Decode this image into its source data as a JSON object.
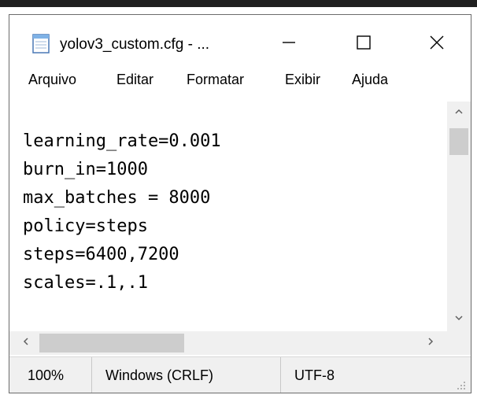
{
  "window": {
    "title": "yolov3_custom.cfg - ...",
    "app_icon": "notepad-icon"
  },
  "controls": {
    "minimize_icon": "minimize-icon",
    "maximize_icon": "maximize-icon",
    "close_icon": "close-icon"
  },
  "menu": {
    "items": [
      {
        "label": "Arquivo"
      },
      {
        "label": "Editar"
      },
      {
        "label": "Formatar"
      },
      {
        "label": "Exibir"
      },
      {
        "label": "Ajuda"
      }
    ]
  },
  "editor": {
    "lines": [
      "learning_rate=0.001",
      "burn_in=1000",
      "max_batches = 8000",
      "policy=steps",
      "steps=6400,7200",
      "scales=.1,.1"
    ]
  },
  "status": {
    "zoom": "100%",
    "line_ending": "Windows (CRLF)",
    "encoding": "UTF-8"
  },
  "colors": {
    "chrome_bg": "#f0f0f0",
    "scroll_thumb": "#cdcdcd",
    "border": "#6b6b6b"
  }
}
